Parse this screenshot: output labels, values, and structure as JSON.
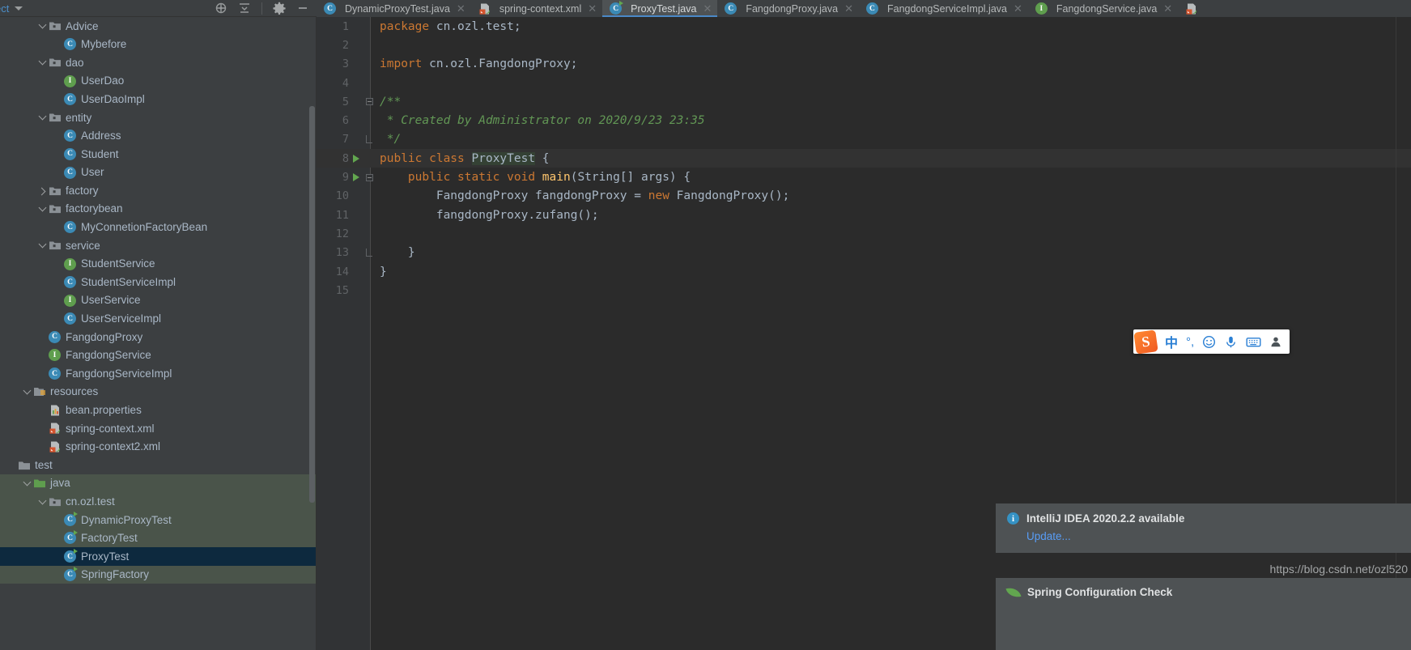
{
  "window": {
    "panel_title": "ect",
    "toolbar_icons": [
      "locate-icon",
      "collapse-all-icon",
      "gear-icon",
      "minimize-icon"
    ]
  },
  "tabs": [
    {
      "label": "DynamicProxyTest.java",
      "icon": "java-class-icon",
      "icon_type": "c",
      "active": false,
      "closable": true
    },
    {
      "label": "spring-context.xml",
      "icon": "spring-xml-icon",
      "icon_type": "xml",
      "active": false,
      "closable": true
    },
    {
      "label": "ProxyTest.java",
      "icon": "java-runnable-class-icon",
      "icon_type": "c-run",
      "active": true,
      "closable": true
    },
    {
      "label": "FangdongProxy.java",
      "icon": "java-class-icon",
      "icon_type": "c",
      "active": false,
      "closable": true
    },
    {
      "label": "FangdongServiceImpl.java",
      "icon": "java-class-icon",
      "icon_type": "c",
      "active": false,
      "closable": true
    },
    {
      "label": "FangdongService.java",
      "icon": "java-interface-icon",
      "icon_type": "i",
      "active": false,
      "closable": true
    },
    {
      "label": "",
      "icon": "spring-xml-icon",
      "icon_type": "xml",
      "active": false,
      "closable": false
    }
  ],
  "sidebar": {
    "rows": [
      {
        "label": "Advice",
        "indent": 2,
        "twisty": "open",
        "icon": "package-folder-icon",
        "state": ""
      },
      {
        "label": "Mybefore",
        "indent": 3,
        "twisty": "none",
        "icon": "java-class-icon",
        "state": ""
      },
      {
        "label": "dao",
        "indent": 2,
        "twisty": "open",
        "icon": "package-folder-icon",
        "state": ""
      },
      {
        "label": "UserDao",
        "indent": 3,
        "twisty": "none",
        "icon": "java-interface-icon",
        "state": ""
      },
      {
        "label": "UserDaoImpl",
        "indent": 3,
        "twisty": "none",
        "icon": "java-class-icon",
        "state": ""
      },
      {
        "label": "entity",
        "indent": 2,
        "twisty": "open",
        "icon": "package-folder-icon",
        "state": ""
      },
      {
        "label": "Address",
        "indent": 3,
        "twisty": "none",
        "icon": "java-class-icon",
        "state": ""
      },
      {
        "label": "Student",
        "indent": 3,
        "twisty": "none",
        "icon": "java-class-icon",
        "state": ""
      },
      {
        "label": "User",
        "indent": 3,
        "twisty": "none",
        "icon": "java-class-icon",
        "state": ""
      },
      {
        "label": "factory",
        "indent": 2,
        "twisty": "closed",
        "icon": "package-folder-icon",
        "state": ""
      },
      {
        "label": "factorybean",
        "indent": 2,
        "twisty": "open",
        "icon": "package-folder-icon",
        "state": ""
      },
      {
        "label": "MyConnetionFactoryBean",
        "indent": 3,
        "twisty": "none",
        "icon": "java-class-icon",
        "state": ""
      },
      {
        "label": "service",
        "indent": 2,
        "twisty": "open",
        "icon": "package-folder-icon",
        "state": ""
      },
      {
        "label": "StudentService",
        "indent": 3,
        "twisty": "none",
        "icon": "java-interface-icon",
        "state": ""
      },
      {
        "label": "StudentServiceImpl",
        "indent": 3,
        "twisty": "none",
        "icon": "java-class-icon",
        "state": ""
      },
      {
        "label": "UserService",
        "indent": 3,
        "twisty": "none",
        "icon": "java-interface-icon",
        "state": ""
      },
      {
        "label": "UserServiceImpl",
        "indent": 3,
        "twisty": "none",
        "icon": "java-class-icon",
        "state": ""
      },
      {
        "label": "FangdongProxy",
        "indent": 2,
        "twisty": "none",
        "icon": "java-class-icon",
        "state": ""
      },
      {
        "label": "FangdongService",
        "indent": 2,
        "twisty": "none",
        "icon": "java-interface-icon",
        "state": ""
      },
      {
        "label": "FangdongServiceImpl",
        "indent": 2,
        "twisty": "none",
        "icon": "java-class-icon",
        "state": ""
      },
      {
        "label": "resources",
        "indent": 1,
        "twisty": "open",
        "icon": "resources-folder-icon",
        "state": ""
      },
      {
        "label": "bean.properties",
        "indent": 2,
        "twisty": "none",
        "icon": "properties-file-icon",
        "state": ""
      },
      {
        "label": "spring-context.xml",
        "indent": 2,
        "twisty": "none",
        "icon": "spring-xml-icon",
        "state": ""
      },
      {
        "label": "spring-context2.xml",
        "indent": 2,
        "twisty": "none",
        "icon": "spring-xml-icon",
        "state": ""
      },
      {
        "label": "test",
        "indent": 0,
        "twisty": "none",
        "icon": "folder-icon",
        "state": ""
      },
      {
        "label": "java",
        "indent": 1,
        "twisty": "open",
        "icon": "test-source-folder-icon",
        "state": "mod-test"
      },
      {
        "label": "cn.ozl.test",
        "indent": 2,
        "twisty": "open",
        "icon": "package-folder-icon",
        "state": "mod-test"
      },
      {
        "label": "DynamicProxyTest",
        "indent": 3,
        "twisty": "none",
        "icon": "java-runnable-class-icon",
        "state": "mod-test"
      },
      {
        "label": "FactoryTest",
        "indent": 3,
        "twisty": "none",
        "icon": "java-runnable-class-icon",
        "state": "mod-test"
      },
      {
        "label": "ProxyTest",
        "indent": 3,
        "twisty": "none",
        "icon": "java-runnable-class-icon",
        "state": "selected"
      },
      {
        "label": "SpringFactory",
        "indent": 3,
        "twisty": "none",
        "icon": "java-runnable-class-icon",
        "state": "mod-test"
      }
    ]
  },
  "editor": {
    "file": "ProxyTest.java",
    "lines": [
      {
        "num": "1",
        "run": false,
        "fold": "",
        "tokens": [
          {
            "t": "package ",
            "c": "kw"
          },
          {
            "t": "cn.ozl.test;",
            "c": "plain"
          }
        ]
      },
      {
        "num": "2",
        "run": false,
        "fold": "",
        "tokens": []
      },
      {
        "num": "3",
        "run": false,
        "fold": "",
        "tokens": [
          {
            "t": "import ",
            "c": "kw"
          },
          {
            "t": "cn.ozl.FangdongProxy;",
            "c": "plain"
          }
        ]
      },
      {
        "num": "4",
        "run": false,
        "fold": "",
        "tokens": []
      },
      {
        "num": "5",
        "run": false,
        "fold": "start",
        "tokens": [
          {
            "t": "/**",
            "c": "cmt"
          }
        ]
      },
      {
        "num": "6",
        "run": false,
        "fold": "",
        "tokens": [
          {
            "t": " * Created by Administrator on 2020/9/23 23:35",
            "c": "cmt"
          }
        ]
      },
      {
        "num": "7",
        "run": false,
        "fold": "end",
        "tokens": [
          {
            "t": " */",
            "c": "cmt"
          }
        ]
      },
      {
        "num": "8",
        "run": true,
        "fold": "",
        "hl": true,
        "tokens": [
          {
            "t": "public class ",
            "c": "kw"
          },
          {
            "t": "ProxyTest",
            "c": "cls-hl"
          },
          {
            "t": " {",
            "c": "plain"
          }
        ]
      },
      {
        "num": "9",
        "run": true,
        "fold": "start",
        "tokens": [
          {
            "t": "    public static void ",
            "c": "kw"
          },
          {
            "t": "main",
            "c": "mth"
          },
          {
            "t": "(String[] args) {",
            "c": "plain"
          }
        ]
      },
      {
        "num": "10",
        "run": false,
        "fold": "",
        "tokens": [
          {
            "t": "        FangdongProxy fangdongProxy = ",
            "c": "plain"
          },
          {
            "t": "new ",
            "c": "kw"
          },
          {
            "t": "FangdongProxy();",
            "c": "plain"
          }
        ]
      },
      {
        "num": "11",
        "run": false,
        "fold": "",
        "tokens": [
          {
            "t": "        fangdongProxy.zufang();",
            "c": "plain"
          }
        ]
      },
      {
        "num": "12",
        "run": false,
        "fold": "",
        "tokens": []
      },
      {
        "num": "13",
        "run": false,
        "fold": "end",
        "tokens": [
          {
            "t": "    }",
            "c": "plain"
          }
        ]
      },
      {
        "num": "14",
        "run": false,
        "fold": "",
        "tokens": [
          {
            "t": "}",
            "c": "plain"
          }
        ]
      },
      {
        "num": "15",
        "run": false,
        "fold": "",
        "tokens": []
      }
    ]
  },
  "ime": {
    "name": "sogou-input-method",
    "logo": "S",
    "items": [
      {
        "glyph": "中",
        "name": "chinese-mode-icon"
      },
      {
        "glyph": "°,",
        "name": "punctuation-mode-icon"
      },
      {
        "glyph": "☺",
        "name": "emoji-icon"
      },
      {
        "glyph": "🎤",
        "name": "voice-input-icon"
      },
      {
        "glyph": "⌨",
        "name": "soft-keyboard-icon"
      },
      {
        "glyph": "☻",
        "name": "user-account-icon"
      }
    ]
  },
  "notifications": [
    {
      "title": "IntelliJ IDEA 2020.2.2 available",
      "link": "Update...",
      "icon": "info-icon"
    },
    {
      "title": "Spring Configuration Check",
      "link": "",
      "icon": "spring-leaf-icon"
    }
  ],
  "watermark": "https://blog.csdn.net/ozl520",
  "colors": {
    "panel_bg": "#3c3f41",
    "editor_bg": "#2b2b2b",
    "gutter_bg": "#313335",
    "selection_blue": "#0d293e",
    "test_module_green": "#4a544a",
    "accent_blue": "#4a88c7",
    "link_blue": "#589df6",
    "keyword_orange": "#cc7832",
    "comment_green": "#629755",
    "method_yellow": "#ffc66d",
    "text_default": "#a9b7c6",
    "class_badge": "#3b8ab5",
    "interface_badge": "#5f9e4e",
    "ime_orange": "#f05a22"
  }
}
